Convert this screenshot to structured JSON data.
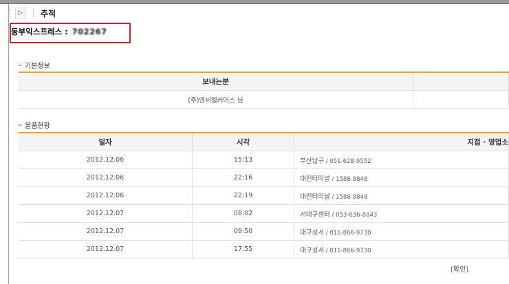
{
  "page": {
    "title": "추적",
    "tracking_label": "동부익스프레스 :",
    "tracking_number": "702267"
  },
  "toolbar": {
    "play_symbol": "▷"
  },
  "sender_section": {
    "title": "기본정보",
    "headers": [
      "보내는분",
      ""
    ],
    "row": [
      "(주)엔씨엘커머스 님",
      ""
    ]
  },
  "status_section": {
    "title": "물품현황",
    "headers": [
      "일자",
      "시각",
      "지점 · 영업소"
    ],
    "rows": [
      {
        "date": "2012.12.06",
        "time": "15:13",
        "branch": "부산남구",
        "phone": " / 051-628-9552"
      },
      {
        "date": "2012.12.06",
        "time": "22:16",
        "branch": "대전터미널",
        "phone": " / 1588-8848"
      },
      {
        "date": "2012.12.06",
        "time": "22:19",
        "branch": "대전터미널",
        "phone": " / 1588-8848"
      },
      {
        "date": "2012.12.07",
        "time": "08:02",
        "branch": "서대구센터",
        "phone": " / 053-636-8843"
      },
      {
        "date": "2012.12.07",
        "time": "09:50",
        "branch": "대구성서",
        "phone": " / 011-866-9730"
      },
      {
        "date": "2012.12.07",
        "time": "17:55",
        "branch": "대구성서",
        "phone": " / 011-866-9730"
      }
    ]
  },
  "confirm_label": "[확인]"
}
